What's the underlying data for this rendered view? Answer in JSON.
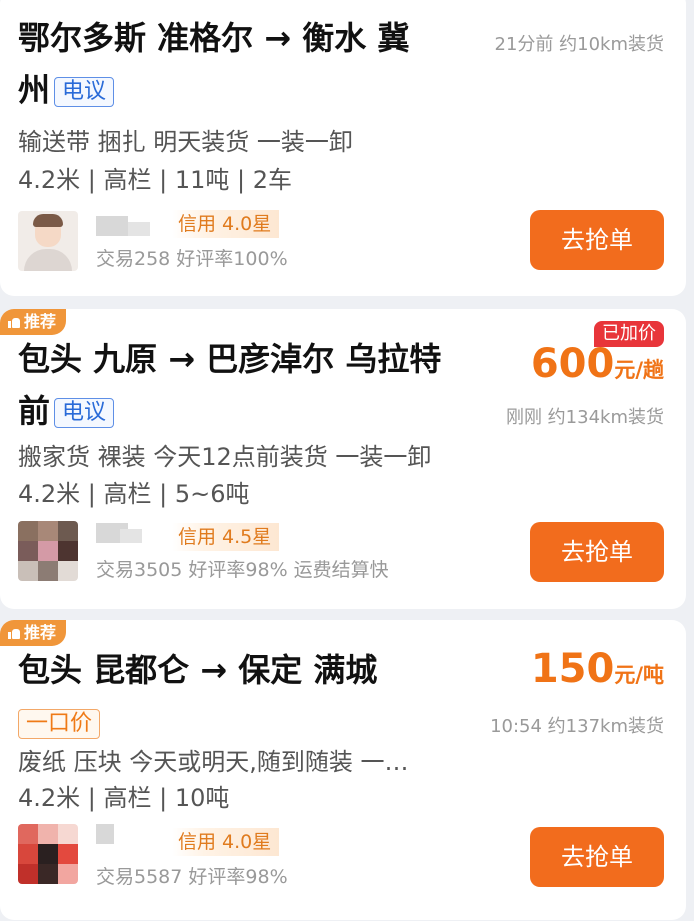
{
  "cards": [
    {
      "route_line1": "鄂尔多斯 准格尔 → 衡水 冀",
      "route_line2": "州",
      "price_badge": "电议",
      "meta": "21分前 约10km装货",
      "cargo": "输送带 捆扎 明天装货 一装一卸",
      "truck": "4.2米 | 高栏 | 11吨 | 2车",
      "credit": "信用 4.0星",
      "stats": "交易258 好评率100%",
      "button": "去抢单"
    },
    {
      "tag": "推荐",
      "route_line1": "包头 九原 → 巴彦淖尔 乌拉特",
      "route_line2": "前",
      "price_badge": "电议",
      "raised": "已加价",
      "price_num": "600",
      "price_unit": "元/趟",
      "meta": "刚刚 约134km装货",
      "cargo": "搬家货 裸装 今天12点前装货 一装一卸",
      "truck": "4.2米 | 高栏 | 5~6吨",
      "credit": "信用 4.5星",
      "stats": "交易3505 好评率98% 运费结算快",
      "button": "去抢单"
    },
    {
      "tag": "推荐",
      "route_line1": "包头 昆都仑 → 保定 满城",
      "price_badge": "一口价",
      "price_num": "150",
      "price_unit": "元/吨",
      "meta": "10:54 约137km装货",
      "cargo": "废纸 压块 今天或明天,随到随装 一…",
      "truck": "4.2米 | 高栏 | 10吨",
      "credit": "信用 4.0星",
      "stats": "交易5587 好评率98%",
      "button": "去抢单"
    }
  ],
  "colors": {
    "accent": "#f26c1d",
    "price": "#f07316",
    "raised": "#e8353a",
    "badge_blue": "#2a6bd8",
    "tag": "#f0963a"
  }
}
